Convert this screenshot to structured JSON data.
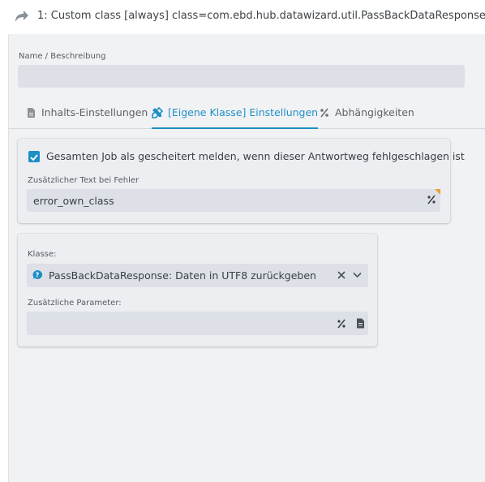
{
  "header": {
    "title": "1: Custom class [always] class=com.ebd.hub.datawizard.util.PassBackDataResponse",
    "icon": "redo-arrow-icon"
  },
  "name_field": {
    "label": "Name / Beschreibung",
    "value": ""
  },
  "tabs": [
    {
      "label": "Inhalts-Einstellungen",
      "icon": "document-icon",
      "active": false
    },
    {
      "label": "[Eigene Klasse] Einstellungen",
      "icon": "tools-icon",
      "active": true
    },
    {
      "label": "Abhängigkeiten",
      "icon": "percent-icon",
      "active": false
    }
  ],
  "error_card": {
    "checkbox_label": "Gesamten Job als gescheitert melden, wenn dieser Antwortweg fehlgeschlagen ist",
    "checked": true,
    "extra_text_label": "Zusätzlicher Text bei Fehler",
    "extra_text_value": "error_own_class"
  },
  "class_card": {
    "class_label": "Klasse:",
    "class_value": "PassBackDataResponse: Daten in UTF8 zurückgeben",
    "params_label": "Zusätzliche Parameter:",
    "params_value": ""
  },
  "colors": {
    "accent": "#1e8fc6",
    "field_bg": "#dde1e7",
    "panel_bg": "#f1f2f4"
  }
}
